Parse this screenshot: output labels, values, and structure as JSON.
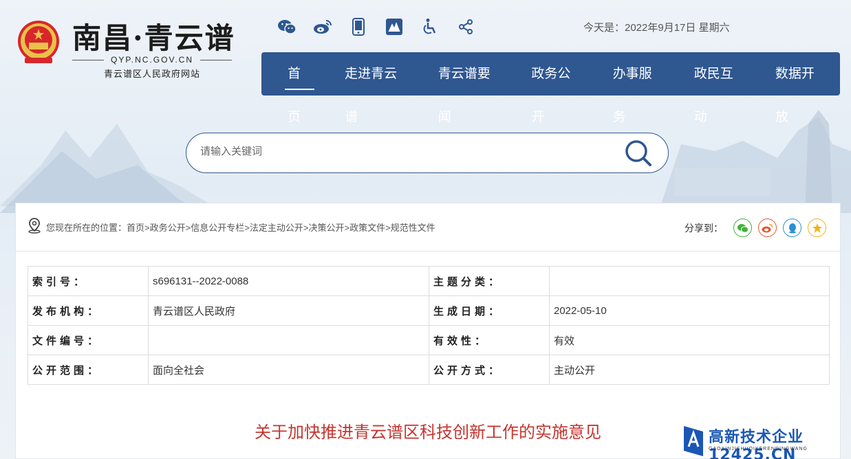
{
  "header": {
    "site_title": "南昌·青云谱",
    "site_domain": "QYP.NC.GOV.CN",
    "site_subtitle": "青云谱区人民政府网站",
    "date_text": "今天是：2022年9月17日 星期六",
    "top_icons": [
      "wechat-icon",
      "weibo-icon",
      "mobile-icon",
      "app-icon",
      "accessibility-icon",
      "share-icon"
    ]
  },
  "nav": {
    "items": [
      {
        "label": "首页",
        "active": true
      },
      {
        "label": "走进青云谱"
      },
      {
        "label": "青云谱要闻"
      },
      {
        "label": "政务公开"
      },
      {
        "label": "办事服务"
      },
      {
        "label": "政民互动"
      },
      {
        "label": "数据开放"
      }
    ]
  },
  "search": {
    "placeholder": "请输入关键词"
  },
  "breadcrumb": {
    "prefix": "您现在所在的位置：",
    "items": [
      "首页",
      "政务公开",
      "信息公开专栏",
      "法定主动公开",
      "决策公开",
      "政策文件",
      "规范性文件"
    ]
  },
  "share": {
    "label": "分享到：",
    "buttons": [
      {
        "name": "wechat-share-icon",
        "color": "#3fb13b"
      },
      {
        "name": "weibo-share-icon",
        "color": "#e4572e"
      },
      {
        "name": "qq-share-icon",
        "color": "#2a8fd6"
      },
      {
        "name": "qzone-share-icon",
        "color": "#f0b21b"
      }
    ]
  },
  "meta": {
    "rows": [
      {
        "k1": "索引号：",
        "v1": "s696131--2022-0088",
        "k2": "主题分类：",
        "v2": ""
      },
      {
        "k1": "发布机构：",
        "v1": "青云谱区人民政府",
        "k2": "生成日期：",
        "v2": "2022-05-10"
      },
      {
        "k1": "文件编号：",
        "v1": "",
        "k2": "有效性：",
        "v2": "有效"
      },
      {
        "k1": "公开范围：",
        "v1": "面向全社会",
        "k2": "公开方式：",
        "v2": "主动公开"
      }
    ]
  },
  "document": {
    "title": "关于加快推进青云谱区科技创新工作的实施意见"
  },
  "watermark": {
    "text": "高新技术企业12425.CN",
    "sub": "GAOXINJISHUQIYERENDINGWANG"
  },
  "colors": {
    "nav_bg": "#2f5790",
    "title_red": "#c5352f",
    "page_bg": "#e8eff6"
  }
}
